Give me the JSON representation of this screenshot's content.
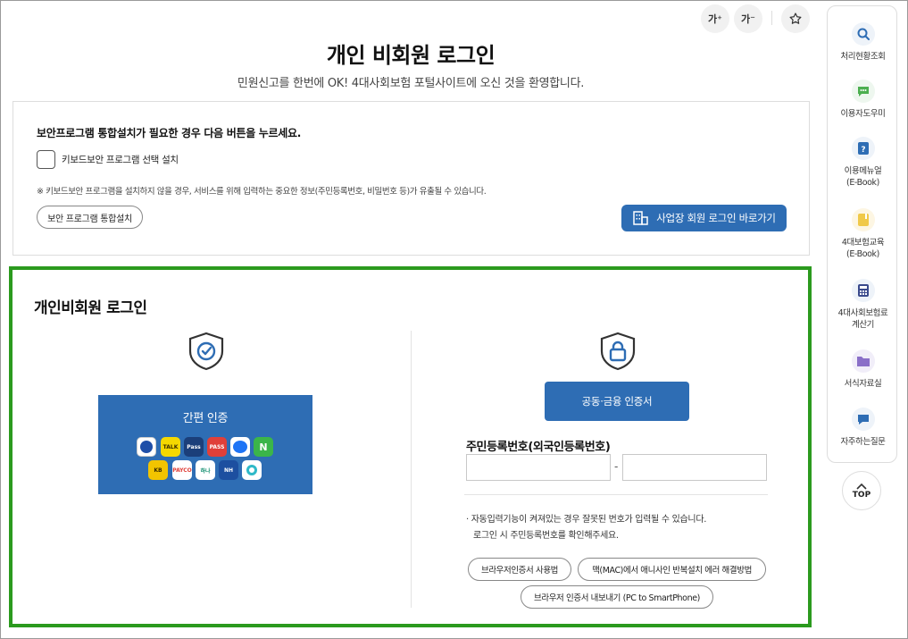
{
  "toolbar": {
    "font_increase_label": "가⁺",
    "font_decrease_label": "가⁻",
    "favorite_icon": "star-icon"
  },
  "header": {
    "title": "개인 비회원 로그인",
    "subtitle": "민원신고를 한번에 OK! 4대사회보험 포털사이트에 오신 것을 환영합니다."
  },
  "security": {
    "title": "보안프로그램 통합설치가 필요한 경우 다음 버튼을 누르세요.",
    "checkbox_label": "키보드보안 프로그램 선택 설치",
    "checkbox_checked": false,
    "note": "※ 키보드보안 프로그램을 설치하지 않을 경우, 서비스를 위해 입력하는 중요한 정보(주민등록번호, 비밀번호 등)가 유출될 수 있습니다.",
    "install_button": "보안 프로그램 통합설치",
    "business_login_button": "사업장 회원 로그인 바로가기"
  },
  "login": {
    "title": "개인비회원 로그인",
    "simple_auth": {
      "label": "간편 인증",
      "apps": [
        {
          "name": "신한은행",
          "color": "#1f4fa8"
        },
        {
          "name": "TALK",
          "color": "#f5d800"
        },
        {
          "name": "Pass",
          "color": "#1b3f7a"
        },
        {
          "name": "PASS",
          "color": "#e0403a"
        },
        {
          "name": "toss",
          "color": "#ffffff"
        },
        {
          "name": "N",
          "color": "#3bb54a"
        },
        {
          "name": "KB",
          "color": "#f2c400"
        },
        {
          "name": "PAYCO",
          "color": "#ffffff"
        },
        {
          "name": "하나",
          "color": "#ffffff"
        },
        {
          "name": "NH",
          "color": "#1d4fa0"
        },
        {
          "name": "bank",
          "color": "#ffffff"
        }
      ]
    },
    "certificate_button": "공동·금융 인증서",
    "rrn_label": "주민등록번호(외국인등록번호)",
    "rrn_front_value": "",
    "rrn_back_value": "",
    "rrn_separator": "-",
    "notice_line1": "자동입력기능이 켜져있는 경우 잘못된 번호가 입력될 수 있습니다.",
    "notice_line2": "로그인 시 주민등록번호를 확인해주세요.",
    "links": {
      "browser_cert": "브라우저인증서 사용법",
      "mac_fix": "맥(MAC)에서 애니사인 반복설치 에러 해결방법",
      "export_cert": "브라우저 인증서 내보내기 (PC to SmartPhone)"
    }
  },
  "sidebar": {
    "items": [
      {
        "label": "처리현황조회",
        "icon": "search-icon"
      },
      {
        "label": "이용자도우미",
        "icon": "chat-icon"
      },
      {
        "label": "이용메뉴얼\n(E-Book)",
        "icon": "question-icon"
      },
      {
        "label": "4대보험교육\n(E-Book)",
        "icon": "book-icon"
      },
      {
        "label": "4대사회보험료\n계산기",
        "icon": "calculator-icon"
      },
      {
        "label": "서식자료실",
        "icon": "folder-icon"
      },
      {
        "label": "자주하는질문",
        "icon": "speech-bubble-icon"
      }
    ],
    "top_label": "TOP"
  },
  "colors": {
    "primary": "#2e6db4",
    "highlight_border": "#2b9a1e"
  }
}
